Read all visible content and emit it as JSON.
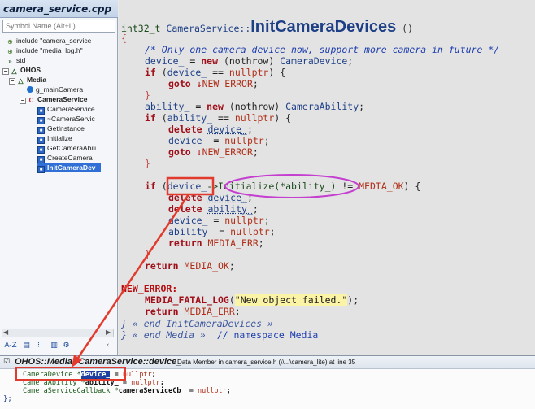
{
  "sidebar": {
    "file_title": "camera_service.cpp",
    "search_placeholder": "Symbol Name (Alt+L)",
    "items": [
      {
        "label": "include \"camera_service"
      },
      {
        "label": "include \"media_log.h\""
      },
      {
        "label": "std"
      },
      {
        "label": "OHOS"
      },
      {
        "label": "Media"
      },
      {
        "label": "g_mainCamera"
      },
      {
        "label": "CameraService"
      },
      {
        "label": "CameraService"
      },
      {
        "label": "~CameraServic"
      },
      {
        "label": "GetInstance"
      },
      {
        "label": "Initialize"
      },
      {
        "label": "GetCameraAbili"
      },
      {
        "label": "CreateCamera"
      },
      {
        "label": "InitCameraDev"
      }
    ],
    "toolbar": {
      "sort_label": "A-Z"
    }
  },
  "editor": {
    "sig_return": "int32_t ",
    "sig_class": "CameraService::",
    "sig_func": "InitCameraDevices",
    "sig_parens": " ()",
    "open_brace": "{",
    "comment": "/* Only one camera device now, support more camera in future */",
    "kw_new": "new",
    "kw_if": "if",
    "kw_goto": "goto",
    "kw_delete": "delete",
    "kw_return": "return",
    "nothrow": " (nothrow) ",
    "camera_device_cls": "CameraDevice",
    "camera_ability_cls": "CameraAbility",
    "device_var": "device_",
    "ability_var": "ability_",
    "assign": " = ",
    "semicolon": ";",
    "eq_null": " == ",
    "nullptr": "nullptr",
    "paren_open": " (",
    "paren_close": ")",
    "rparen_brace": ") {",
    "close_brace": "}",
    "new_error": "NEW_ERROR",
    "goto_arrow": "↓",
    "arrow_op": "->",
    "initialize_call": "Initialize(*ability_)",
    "neq": " != ",
    "media_ok": "MEDIA_OK",
    "media_err": "MEDIA_ERR",
    "label_colon": ":",
    "fatal_log": "MEDIA_FATAL_LOG",
    "log_string": "\"New object failed.\"",
    "end_fn": "} « end InitCameraDevices »",
    "end_ns": "} « end Media »",
    "ns_comment": "  // namespace Media"
  },
  "info_panel": {
    "symbol": "OHOS::Media::CameraService::device_",
    "description": "Data Member in camera_service.h (\\\\...\\camera_lite) at line 35",
    "lines": [
      {
        "type": "CameraDevice *",
        "name": "device_",
        "assign": " = ",
        "val": "nullptr",
        "end": ";"
      },
      {
        "type": "CameraAbility *",
        "name": "ability_",
        "assign": " = ",
        "val": "nullptr",
        "end": ";"
      },
      {
        "type": "CameraServiceCallback *",
        "name": "cameraServiceCb_",
        "assign": " = ",
        "val": "nullptr",
        "end": ";"
      }
    ],
    "closing": "};"
  },
  "colors": {
    "annotation_red": "#e23b2e",
    "annotation_magenta": "#c43fd0",
    "selection_blue": "#2f6fd6"
  }
}
